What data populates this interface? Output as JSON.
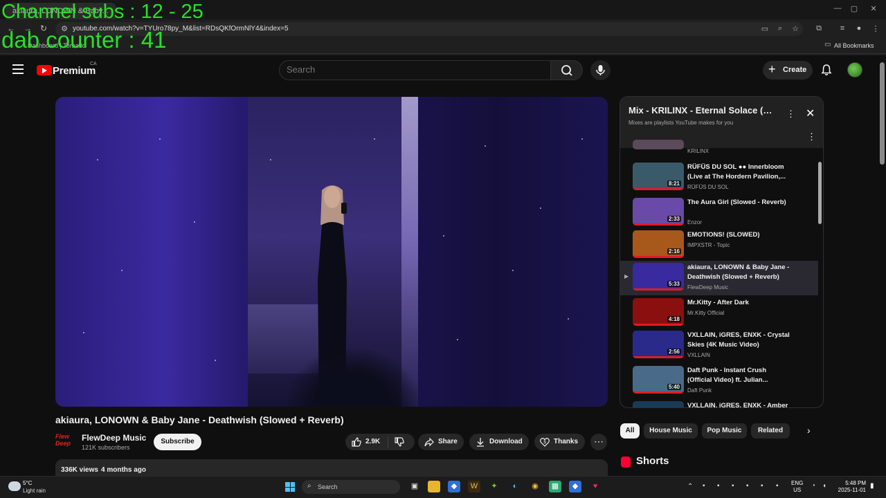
{
  "overlay": {
    "channel_subs": "Channel subs : 12 - 25",
    "dab_counter": "dab counter : 41"
  },
  "browser": {
    "tab_title": "akiaura, LONOWN & Baby...",
    "url": "youtube.com/watch?v=TYUro78py_M&list=RDsQKfOrmNlY4&index=5",
    "bookmark_item": "Dashboard | Tornado",
    "all_bookmarks": "All Bookmarks"
  },
  "header": {
    "brand": "Premium",
    "region": "CA",
    "search_placeholder": "Search",
    "create_label": "Create"
  },
  "video": {
    "title": "akiaura, LONOWN & Baby Jane - Deathwish (Slowed + Reverb)",
    "channel_logo": "Flew Deep",
    "channel_name": "FlewDeep Music",
    "subscribers": "121K subscribers",
    "subscribe_label": "Subscribe",
    "likes": "2.9K",
    "share_label": "Share",
    "download_label": "Download",
    "thanks_label": "Thanks",
    "views": "336K views",
    "age": "4 months ago"
  },
  "playlist": {
    "title": "Mix - KRILINX - Eternal Solace (Slowed + Reverb)",
    "subtitle": "Mixes are playlists YouTube makes for you",
    "first_partial_channel": "KRILINX",
    "items": [
      {
        "title": "RÜFÜS DU SOL ●● Innerbloom (Live at The Hordern Pavilion,...",
        "channel": "RÜFÜS DU SOL",
        "duration": "8:21",
        "thumb_color": "#3a5a6a"
      },
      {
        "title": "The Aura Girl (Slowed - Reverb)",
        "channel": "Enzor",
        "duration": "2:33",
        "thumb_color": "#6a4aa8"
      },
      {
        "title": "EMOTIONS! (SLOWED)",
        "channel": "IMPXSTR - Topic",
        "duration": "2:16",
        "thumb_color": "#a8581a"
      },
      {
        "title": "akiaura, LONOWN & Baby Jane - Deathwish (Slowed + Reverb)",
        "channel": "FlewDeep Music",
        "duration": "5:33",
        "thumb_color": "#3a2aa0",
        "active": true
      },
      {
        "title": "Mr.Kitty - After Dark",
        "channel": "Mr.Kitty Official",
        "duration": "4:18",
        "thumb_color": "#8a1010"
      },
      {
        "title": "VXLLAIN, iGRES, ENXK - Crystal Skies (4K Music Video)",
        "channel": "VXLLAIN",
        "duration": "2:56",
        "thumb_color": "#2a2a8a"
      },
      {
        "title": "Daft Punk - Instant Crush (Official Video) ft. Julian...",
        "channel": "Daft Punk",
        "duration": "5:40",
        "thumb_color": "#4a6a8a"
      },
      {
        "title": "VXLLAIN, iGRES, ENXK - Amber",
        "channel": "",
        "duration": "",
        "thumb_color": "#1a3a5a"
      }
    ]
  },
  "chips": [
    "All",
    "House Music",
    "Pop Music",
    "Related"
  ],
  "shorts_label": "Shorts",
  "taskbar": {
    "weather_temp": "5°C",
    "weather_desc": "Light rain",
    "search_label": "Search",
    "lang_line1": "ENG",
    "lang_line2": "US",
    "time": "5:48 PM",
    "date": "2025-11-01"
  }
}
